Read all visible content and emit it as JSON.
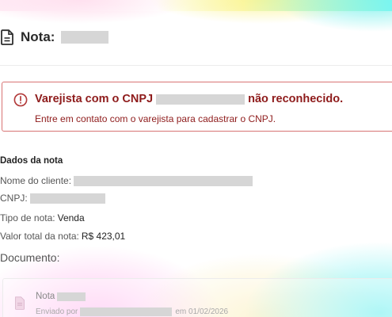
{
  "header": {
    "title": "Nota:",
    "icon": "document-icon"
  },
  "alert": {
    "title_prefix": "Varejista com o CNPJ",
    "title_suffix": "não reconhecido.",
    "message": "Entre em contato com o varejista para cadastrar o CNPJ.",
    "color": "#8e1b1b",
    "border_color": "#d87373",
    "icon": "alert-circle-icon"
  },
  "details": {
    "section_title": "Dados da nota",
    "client_label": "Nome do cliente:",
    "cnpj_label": "CNPJ:",
    "type_label": "Tipo de nota:",
    "type_value": "Venda",
    "total_label": "Valor total da nota:",
    "total_value": "R$ 423,01"
  },
  "document": {
    "section_title": "Documento:",
    "name_label": "Nota",
    "sent_prefix": "Enviado por",
    "sent_suffix": "em 01/02/2026",
    "icon": "file-icon"
  }
}
